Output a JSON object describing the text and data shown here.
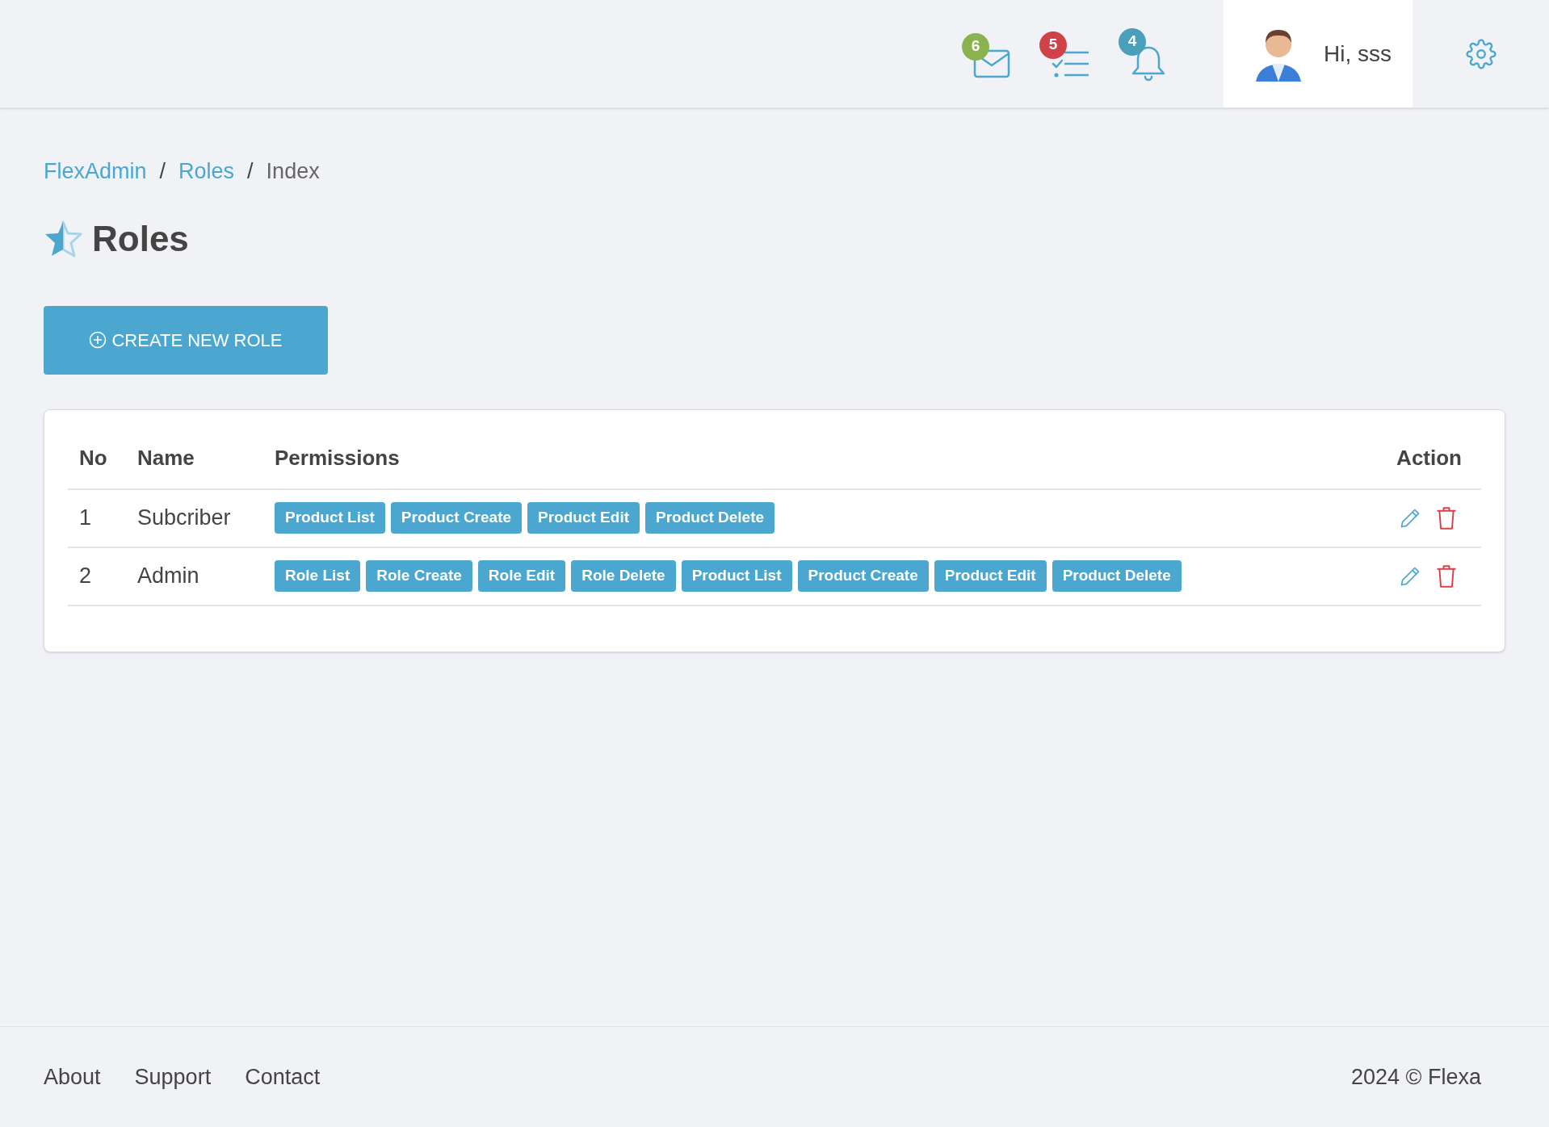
{
  "header": {
    "indicators": [
      {
        "kind": "mail",
        "count": "6",
        "color": "#8ab34f"
      },
      {
        "kind": "tasks",
        "count": "5",
        "color": "#d0414a"
      },
      {
        "kind": "bell",
        "count": "4",
        "color": "#4a9fba"
      }
    ],
    "greeting": "Hi, sss"
  },
  "breadcrumb": [
    {
      "kind": "link",
      "label": "FlexAdmin"
    },
    {
      "kind": "separator",
      "label": "/"
    },
    {
      "kind": "link",
      "label": "Roles"
    },
    {
      "kind": "separator",
      "label": "/"
    },
    {
      "kind": "current",
      "label": "Index"
    }
  ],
  "page_title": "Roles",
  "create_button": "CREATE NEW ROLE",
  "table": {
    "columns": [
      "No",
      "Name",
      "Permissions",
      "Action"
    ],
    "rows": [
      {
        "no": "1",
        "name": "Subcriber",
        "permissions": [
          "Product List",
          "Product Create",
          "Product Edit",
          "Product Delete"
        ]
      },
      {
        "no": "2",
        "name": "Admin",
        "permissions": [
          "Role List",
          "Role Create",
          "Role Edit",
          "Role Delete",
          "Product List",
          "Product Create",
          "Product Edit",
          "Product Delete"
        ]
      }
    ]
  },
  "footer": {
    "links": [
      "About",
      "Support",
      "Contact"
    ],
    "copyright": "2024 © Flexa"
  }
}
